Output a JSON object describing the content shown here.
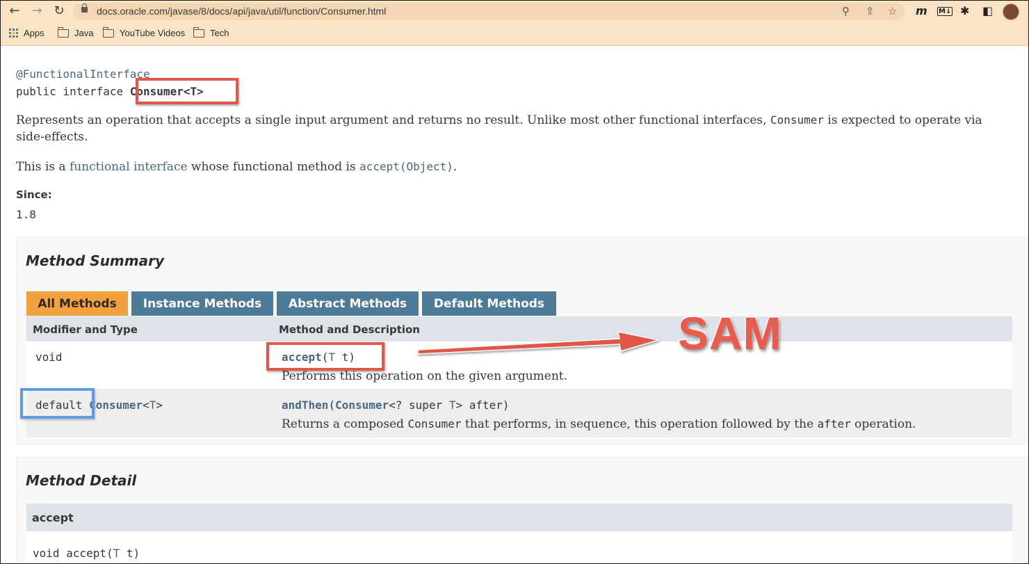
{
  "browser": {
    "url": "docs.oracle.com/javase/8/docs/api/java/util/function/Consumer.html",
    "bookmarks": [
      "Apps",
      "Java",
      "YouTube Videos",
      "Tech"
    ],
    "theme_color": "#fbe3c6"
  },
  "page": {
    "annotation": "@FunctionalInterface",
    "decl_prefix": "public interface ",
    "decl_name": "Consumer<T>",
    "desc1_a": "Represents an operation that accepts a single input argument and returns no result. Unlike most other functional interfaces, ",
    "desc1_code": "Consumer",
    "desc1_b": " is expected to operate via",
    "desc1_line2": "side-effects.",
    "desc2_a": "This is a ",
    "desc2_link": "functional interface",
    "desc2_b": " whose functional method is ",
    "desc2_code": "accept(Object)",
    "desc2_c": ".",
    "since_label": "Since:",
    "since_value": "1.8"
  },
  "summary": {
    "title": "Method Summary",
    "tabs": [
      "All Methods",
      "Instance Methods",
      "Abstract Methods",
      "Default Methods"
    ],
    "col_modifier": "Modifier and Type",
    "col_method": "Method and Description",
    "rows": [
      {
        "modifier": "void",
        "method_name": "accept",
        "method_params_open": "(",
        "method_param_type": "T",
        "method_params_close": " t)",
        "description": "Performs this operation on the given argument."
      },
      {
        "modifier_kw": "default",
        "modifier_type": "Consumer",
        "modifier_lt": "<",
        "modifier_tp": "T",
        "modifier_gt": ">",
        "method_name": "andThen",
        "method_params_open": "(",
        "method_param_type": "Consumer",
        "method_params_mid": "<? super ",
        "method_param_tp": "T",
        "method_params_close": "> after)",
        "desc_a": "Returns a composed ",
        "desc_code1": "Consumer",
        "desc_b": " that performs, in sequence, this operation followed by the ",
        "desc_code2": "after",
        "desc_c": " operation."
      }
    ]
  },
  "callout": {
    "label": "SAM",
    "color": "#ea5a4d"
  },
  "detail": {
    "title": "Method Detail",
    "method_head": "accept",
    "sig_a": "void accept(",
    "sig_tp": "T",
    "sig_b": " t)"
  }
}
